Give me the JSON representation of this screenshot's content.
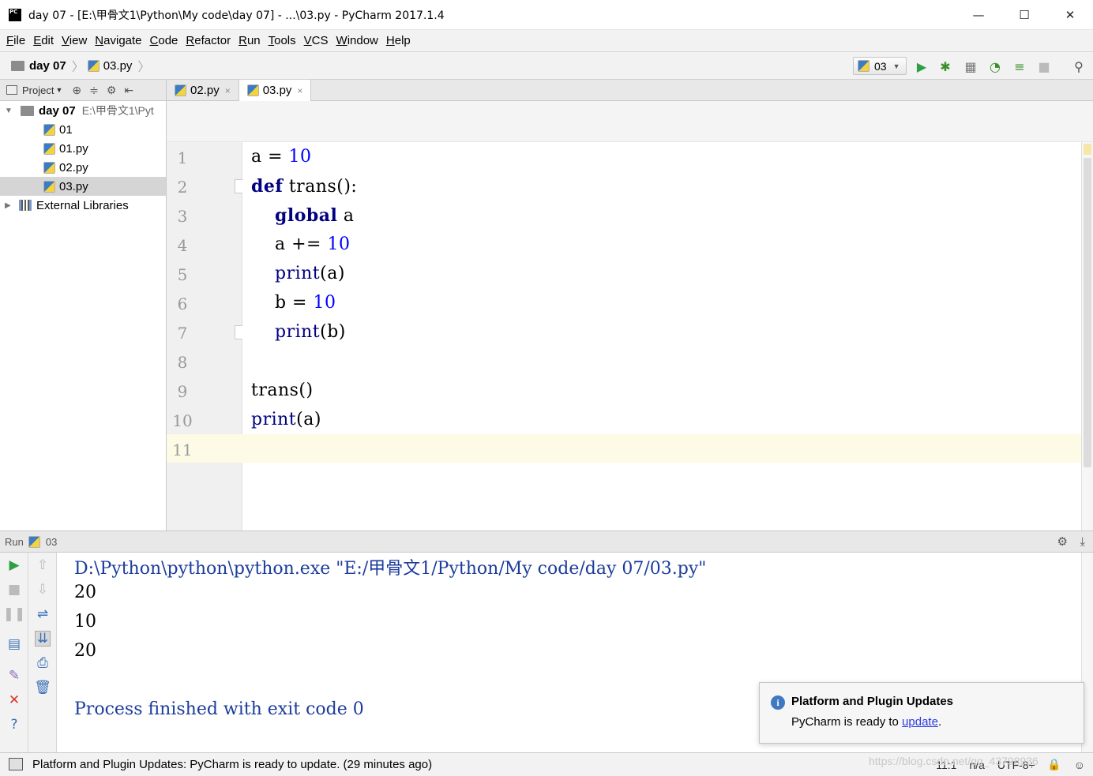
{
  "window": {
    "title": "day 07 - [E:\\甲骨文1\\Python\\My code\\day 07] - ...\\03.py - PyCharm 2017.1.4",
    "app_icon_label": "PC"
  },
  "menu": [
    "File",
    "Edit",
    "View",
    "Navigate",
    "Code",
    "Refactor",
    "Run",
    "Tools",
    "VCS",
    "Window",
    "Help"
  ],
  "breadcrumb": {
    "folder": "day 07",
    "file": "03.py"
  },
  "toolbar": {
    "run_config": "03"
  },
  "project_panel": {
    "header_label": "Project",
    "tree": [
      {
        "label": "day 07",
        "path": "E:\\甲骨文1\\Pyt"
      },
      {
        "label": "01"
      },
      {
        "label": "01.py"
      },
      {
        "label": "02.py"
      },
      {
        "label": "03.py"
      },
      {
        "label": "External Libraries"
      }
    ]
  },
  "tabs": [
    {
      "label": "02.py",
      "close": "×"
    },
    {
      "label": "03.py",
      "close": "×"
    }
  ],
  "editor": {
    "line_numbers": [
      "1",
      "2",
      "3",
      "4",
      "5",
      "6",
      "7",
      "8",
      "9",
      "10",
      "11"
    ],
    "current_line": "11"
  },
  "run_panel": {
    "label": "Run",
    "config": "03",
    "console": {
      "command": "D:\\Python\\python\\python.exe \"E:/甲骨文1/Python/My code/day 07/03.py\"",
      "output": [
        "20",
        "10",
        "20"
      ],
      "exit": "Process finished with exit code 0"
    }
  },
  "notification": {
    "title": "Platform and Plugin Updates",
    "body_prefix": "PyCharm is ready to ",
    "link": "update",
    "body_suffix": "."
  },
  "statusbar": {
    "message": "Platform and Plugin Updates: PyCharm is ready to update. (29 minutes ago)",
    "position": "11:1",
    "line_sep": "n/a",
    "encoding": "UTF-8"
  },
  "watermark": "https://blog.csdn.net/qq_43798936"
}
